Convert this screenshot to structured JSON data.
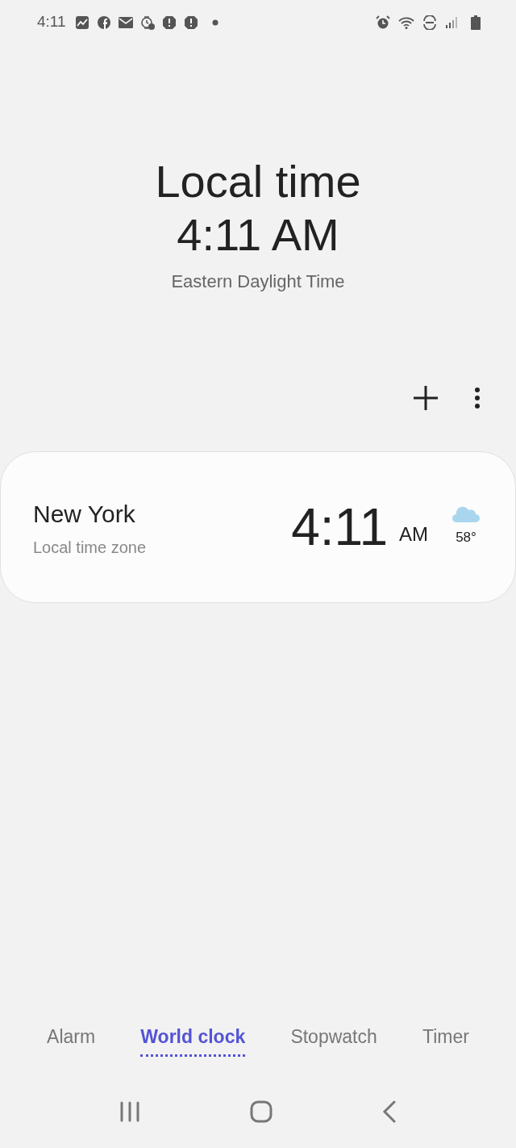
{
  "status_bar": {
    "time": "4:11"
  },
  "header": {
    "title": "Local time",
    "time": "4:11 AM",
    "zone": "Eastern Daylight Time"
  },
  "cities": [
    {
      "name": "New York",
      "subtitle": "Local time zone",
      "time": "4:11",
      "ampm": "AM",
      "temperature": "58°"
    }
  ],
  "tabs": [
    {
      "label": "Alarm",
      "selected": false
    },
    {
      "label": "World clock",
      "selected": true
    },
    {
      "label": "Stopwatch",
      "selected": false
    },
    {
      "label": "Timer",
      "selected": false
    }
  ]
}
